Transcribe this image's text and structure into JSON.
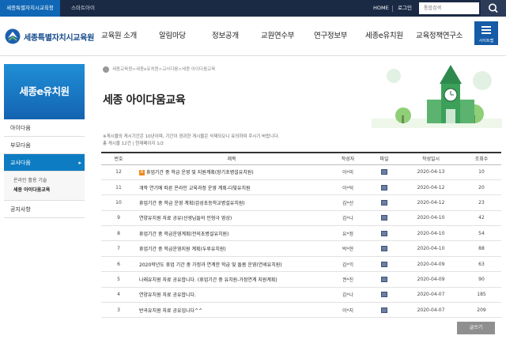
{
  "topbar": {
    "tab_office": "세종특별자치시교육청",
    "tab_smart": "스마트아이",
    "home": "HOME",
    "login": "로그인",
    "search_placeholder": "통합검색"
  },
  "header": {
    "logo_text": "세종특별자치시교육원",
    "nav": [
      "교육원 소개",
      "알림마당",
      "정보공개",
      "교원연수부",
      "연구정보부",
      "세종e유치원",
      "교육정책연구소"
    ],
    "sitemap_label": "사이트맵"
  },
  "sidebar": {
    "title": "세종e유치원",
    "items": [
      {
        "label": "아이다움"
      },
      {
        "label": "부모다움"
      },
      {
        "label": "교사다움"
      },
      {
        "label": "공지사항"
      }
    ],
    "sub_items": [
      "온라인 활용 기술",
      "세종 아이다움교육"
    ]
  },
  "breadcrumb": "세종교육원>세종e유치원>교사다움>세종 아이다움교육",
  "page_title": "세종 아이다움교육",
  "notice": "※게시물의 게시기간은 10년이며, 기간이 경과한 게시물은 삭제되오니 유의하여 주시기 바랍니다.",
  "count_text": "총 게시물 12건 | 현재페이지 1/2",
  "table": {
    "headers": [
      "번호",
      "제목",
      "작성자",
      "파일",
      "작성일시",
      "조회수"
    ],
    "rows": [
      {
        "num": "12",
        "title": "휴업기간 중 학급 운영 및 지원계획(장기초병설유치원)",
        "author": "이*미",
        "date": "2020-04-13",
        "views": "10",
        "new": "N"
      },
      {
        "num": "11",
        "title": "개학 연기에 따른 온라인 교육과정 운영 계획-다빛유치원",
        "author": "이*덕",
        "date": "2020-04-12",
        "views": "20",
        "new": ""
      },
      {
        "num": "10",
        "title": "휴업기간 중 학급 운영 계획(감성초등학교병설유치원)",
        "author": "김*선",
        "date": "2020-04-12",
        "views": "23",
        "new": ""
      },
      {
        "num": "9",
        "title": "연양유치원 자료 공유(선생님들의 인형극 영상)",
        "author": "김*나",
        "date": "2020-04-10",
        "views": "42",
        "new": ""
      },
      {
        "num": "8",
        "title": "휴업기간 중 학급운영계획(전의초병설유치원)",
        "author": "유*정",
        "date": "2020-04-10",
        "views": "54",
        "new": ""
      },
      {
        "num": "7",
        "title": "휴업기간 중 학급운영지원 계획(두루유치원)",
        "author": "박*현",
        "date": "2020-04-10",
        "views": "88",
        "new": ""
      },
      {
        "num": "6",
        "title": "2020학년도 휴업 기간 중 가정과 연계한 학급 및 돌봄 운영(연세유치원)",
        "author": "김*익",
        "date": "2020-04-09",
        "views": "63",
        "new": ""
      },
      {
        "num": "5",
        "title": "나래유치원 자료 공유합니다. (휴업기간 중 유치원-가정연계 지원계획)",
        "author": "권*진",
        "date": "2020-04-09",
        "views": "90",
        "new": ""
      },
      {
        "num": "4",
        "title": "연양유치원 자료 공유합니다.",
        "author": "김*나",
        "date": "2020-04-07",
        "views": "185",
        "new": ""
      },
      {
        "num": "3",
        "title": "반곡유치원 자료 공유입니다^^",
        "author": "이*지",
        "date": "2020-04-07",
        "views": "209",
        "new": ""
      }
    ]
  },
  "write_button": "글쓰기",
  "colors": {
    "topbar": "#1b2a44",
    "accent": "#0e7cc3",
    "brand": "#154a8c"
  }
}
